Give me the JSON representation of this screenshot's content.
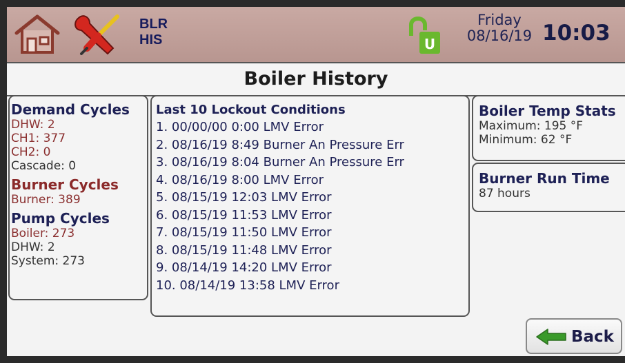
{
  "header": {
    "mode_line1": "BLR",
    "mode_line2": "HIS",
    "day": "Friday",
    "date": "08/16/19",
    "time": "10:03",
    "icons": [
      "home-icon",
      "tools-icon",
      "unlock-icon"
    ]
  },
  "title": "Boiler History",
  "demand_cycles": {
    "title": "Demand Cycles",
    "items": [
      "DHW: 2",
      "CH1: 377",
      "CH2: 0",
      "Cascade: 0"
    ]
  },
  "burner_cycles": {
    "title": "Burner Cycles",
    "items": [
      "Burner: 389"
    ]
  },
  "pump_cycles": {
    "title": "Pump Cycles",
    "items": [
      "Boiler: 273",
      "DHW: 2",
      "System: 273"
    ]
  },
  "lockouts": {
    "title": "Last 10 Lockout Conditions",
    "rows": [
      "1. 00/00/00 0:00 LMV Error",
      "2. 08/16/19 8:49 Burner An Pressure Err",
      "3. 08/16/19 8:04 Burner An Pressure Err",
      "4. 08/16/19 8:00 LMV Error",
      "5. 08/15/19 12:03 LMV Error",
      "6. 08/15/19 11:53 LMV Error",
      "7. 08/15/19 11:50 LMV Error",
      "8. 08/15/19 11:48 LMV Error",
      "9. 08/14/19 14:20 LMV Error",
      "10. 08/14/19 13:58 LMV Error"
    ]
  },
  "temp_stats": {
    "title": "Boiler Temp Stats",
    "max": "Maximum: 195 °F",
    "min": "Minimum: 62 °F"
  },
  "run_time": {
    "title": "Burner Run Time",
    "value": "87 hours"
  },
  "back_button": {
    "label": "Back"
  },
  "colors": {
    "header_bg": "#c0a09a",
    "navy_text": "#1d2055",
    "red_text": "#8b2a2a",
    "arrow_green": "#3a9a2a",
    "unlock_green": "#6ab82e"
  }
}
